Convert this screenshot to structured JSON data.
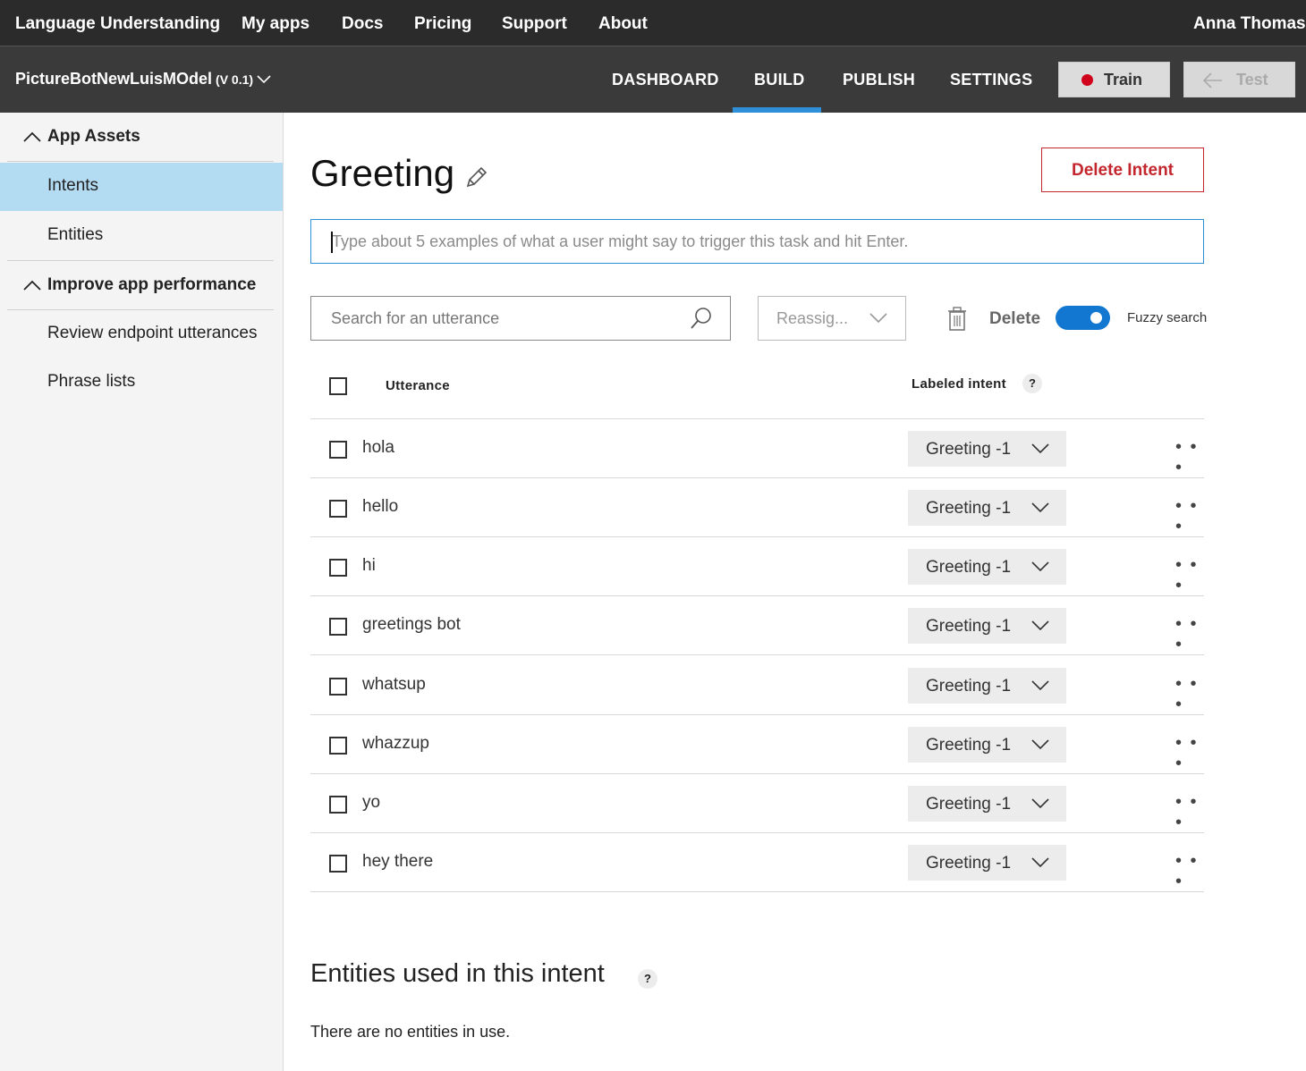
{
  "topnav": {
    "brand": "Language Understanding",
    "items": [
      "My apps",
      "Docs",
      "Pricing",
      "Support",
      "About"
    ],
    "user": "Anna Thomas"
  },
  "appbar": {
    "app_name": "PictureBotNewLuisMOdel",
    "version": "(V 0.1)",
    "tabs": [
      "DASHBOARD",
      "BUILD",
      "PUBLISH",
      "SETTINGS"
    ],
    "active_tab": "BUILD",
    "train_label": "Train",
    "test_label": "Test",
    "accent_color": "#2f8fd8",
    "train_status_color": "#d0021b"
  },
  "sidebar": {
    "section1": "App Assets",
    "items1": [
      "Intents",
      "Entities"
    ],
    "active_item": "Intents",
    "section2": "Improve app performance",
    "items2": [
      "Review endpoint utterances",
      "Phrase lists"
    ]
  },
  "main": {
    "intent_title": "Greeting",
    "delete_intent_label": "Delete Intent",
    "utterance_placeholder": "Type about 5 examples of what a user might say to trigger this task and hit Enter.",
    "search_placeholder": "Search for an utterance",
    "reassign_label": "Reassig...",
    "delete_label": "Delete",
    "fuzzy_label": "Fuzzy search",
    "fuzzy_on": true,
    "col_utterance": "Utterance",
    "col_labeled_intent": "Labeled intent",
    "help_glyph": "?",
    "more_glyph": "• • •",
    "utterances": [
      {
        "text": "hola",
        "intent": "Greeting -1"
      },
      {
        "text": "hello",
        "intent": "Greeting -1"
      },
      {
        "text": "hi",
        "intent": "Greeting -1"
      },
      {
        "text": "greetings bot",
        "intent": "Greeting -1"
      },
      {
        "text": "whatsup",
        "intent": "Greeting -1"
      },
      {
        "text": "whazzup",
        "intent": "Greeting -1"
      },
      {
        "text": "yo",
        "intent": "Greeting -1"
      },
      {
        "text": "hey there",
        "intent": "Greeting -1"
      }
    ],
    "entities_title": "Entities used in this intent",
    "entities_empty": "There are no entities in use."
  }
}
